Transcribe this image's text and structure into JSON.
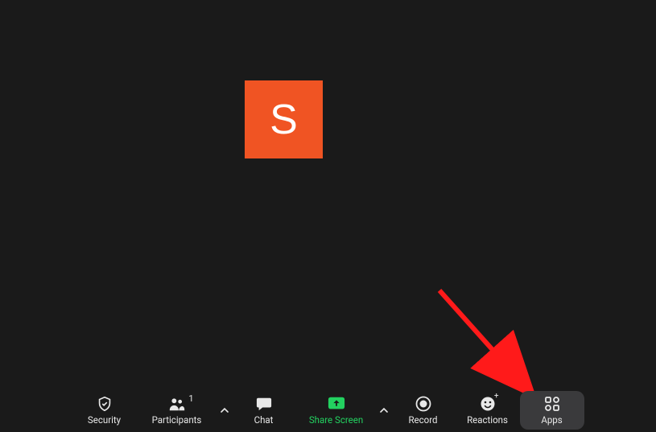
{
  "avatar": {
    "initial": "S",
    "bg": "#F05423"
  },
  "toolbar": {
    "security": "Security",
    "participants": "Participants",
    "participants_count": "1",
    "chat": "Chat",
    "share": "Share Screen",
    "record": "Record",
    "reactions": "Reactions",
    "apps": "Apps"
  },
  "colors": {
    "share_green": "#23D160",
    "highlight_bg": "#3a3a3c",
    "arrow": "#FF1A1A"
  }
}
